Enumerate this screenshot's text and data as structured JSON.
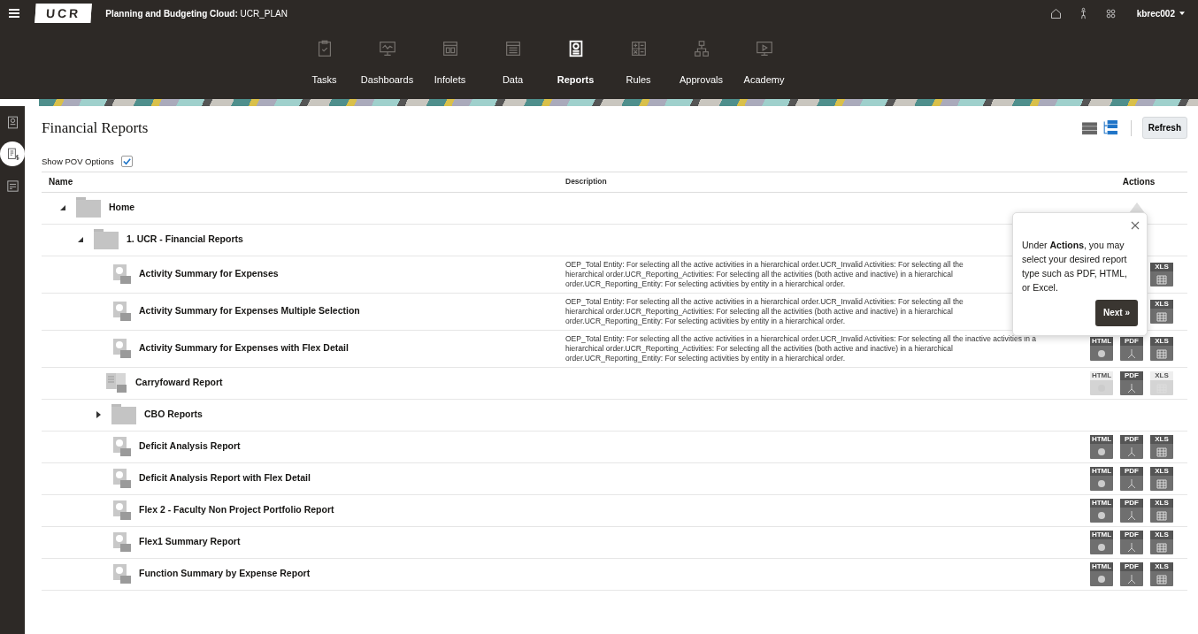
{
  "header": {
    "title_bold": "Planning and Budgeting Cloud:",
    "title": "UCR_PLAN",
    "logo": "UCR",
    "user": "kbrec002"
  },
  "nav": [
    {
      "label": "Tasks",
      "selected": false
    },
    {
      "label": "Dashboards",
      "selected": false
    },
    {
      "label": "Infolets",
      "selected": false
    },
    {
      "label": "Data",
      "selected": false
    },
    {
      "label": "Reports",
      "selected": true
    },
    {
      "label": "Rules",
      "selected": false
    },
    {
      "label": "Approvals",
      "selected": false
    },
    {
      "label": "Academy",
      "selected": false
    }
  ],
  "sidebar": {
    "items": [
      {
        "selected": false
      },
      {
        "selected": true
      },
      {
        "selected": false
      }
    ]
  },
  "page": {
    "title": "Financial Reports",
    "refresh": "Refresh",
    "views": [
      {
        "selected": false
      },
      {
        "selected": true
      }
    ],
    "show_pov": {
      "label": "Show POV Options",
      "checked": true
    }
  },
  "table": {
    "columns": [
      "Name",
      "Description",
      "Actions"
    ],
    "rows": [
      {
        "kind": "folder",
        "name": "Home",
        "expanded": true,
        "children": [
          {
            "kind": "folder",
            "name": "1. UCR - Financial Reports",
            "expanded": true,
            "children": [
              {
                "kind": "report",
                "name": "Activity Summary for Expenses",
                "description": [
                  "OEP_Total Entity: For selecting all the active activities in a hierarchical order.UCR_Invalid Activities: For selecting all the",
                  "hierarchical order.UCR_Reporting_Activities: For selecting all the activities (both active and inactive) in a hierarchical",
                  "order.UCR_Reporting_Entity: For selecting activities by entity in a hierarchical order."
                ],
                "actions": [
                  {
                    "kind": "xls",
                    "label": "XLS",
                    "disabled": false
                  }
                ]
              },
              {
                "kind": "report",
                "name": "Activity Summary for Expenses Multiple Selection",
                "description": [
                  "OEP_Total Entity: For selecting all the active activities in a hierarchical order.UCR_Invalid Activities: For selecting all the",
                  "hierarchical order.UCR_Reporting_Activities: For selecting all the activities (both active and inactive) in a hierarchical",
                  "order.UCR_Reporting_Entity: For selecting activities by entity in a hierarchical order."
                ],
                "actions": [
                  {
                    "kind": "xls",
                    "label": "XLS",
                    "disabled": false
                  }
                ]
              },
              {
                "kind": "report",
                "name": "Activity Summary for Expenses with Flex Detail",
                "description": [
                  "OEP_Total Entity: For selecting all the active activities in a hierarchical order.UCR_Invalid Activities: For selecting all the inactive activities in a",
                  "hierarchical order.UCR_Reporting_Activities: For selecting all the activities (both active and inactive) in a hierarchical",
                  "order.UCR_Reporting_Entity: For selecting activities by entity in a hierarchical order."
                ],
                "actions": [
                  {
                    "kind": "html",
                    "label": "HTML",
                    "disabled": false
                  },
                  {
                    "kind": "pdf",
                    "label": "PDF",
                    "disabled": false
                  },
                  {
                    "kind": "xls",
                    "label": "XLS",
                    "disabled": false
                  }
                ]
              },
              {
                "kind": "book",
                "name": "Carryfoward Report",
                "actions": [
                  {
                    "kind": "html",
                    "label": "HTML",
                    "disabled": true
                  },
                  {
                    "kind": "pdf",
                    "label": "PDF",
                    "disabled": false
                  },
                  {
                    "kind": "xls",
                    "label": "XLS",
                    "disabled": true
                  }
                ]
              },
              {
                "kind": "folder",
                "name": "CBO Reports",
                "expanded": false
              },
              {
                "kind": "report",
                "name": "Deficit Analysis Report",
                "actions": [
                  {
                    "kind": "html",
                    "label": "HTML",
                    "disabled": false
                  },
                  {
                    "kind": "pdf",
                    "label": "PDF",
                    "disabled": false
                  },
                  {
                    "kind": "xls",
                    "label": "XLS",
                    "disabled": false
                  }
                ]
              },
              {
                "kind": "report",
                "name": "Deficit Analysis Report with Flex Detail",
                "actions": [
                  {
                    "kind": "html",
                    "label": "HTML",
                    "disabled": false
                  },
                  {
                    "kind": "pdf",
                    "label": "PDF",
                    "disabled": false
                  },
                  {
                    "kind": "xls",
                    "label": "XLS",
                    "disabled": false
                  }
                ]
              },
              {
                "kind": "report",
                "name": "Flex 2 - Faculty Non Project Portfolio Report",
                "actions": [
                  {
                    "kind": "html",
                    "label": "HTML",
                    "disabled": false
                  },
                  {
                    "kind": "pdf",
                    "label": "PDF",
                    "disabled": false
                  },
                  {
                    "kind": "xls",
                    "label": "XLS",
                    "disabled": false
                  }
                ]
              },
              {
                "kind": "report",
                "name": "Flex1 Summary Report",
                "actions": [
                  {
                    "kind": "html",
                    "label": "HTML",
                    "disabled": false
                  },
                  {
                    "kind": "pdf",
                    "label": "PDF",
                    "disabled": false
                  },
                  {
                    "kind": "xls",
                    "label": "XLS",
                    "disabled": false
                  }
                ]
              },
              {
                "kind": "report",
                "name": "Function Summary by Expense Report",
                "actions": [
                  {
                    "kind": "html",
                    "label": "HTML",
                    "disabled": false
                  },
                  {
                    "kind": "pdf",
                    "label": "PDF",
                    "disabled": false
                  },
                  {
                    "kind": "xls",
                    "label": "XLS",
                    "disabled": false
                  }
                ]
              }
            ]
          }
        ]
      }
    ]
  },
  "popover": {
    "text": "Under **Actions**, you may select your desired report type such as PDF, HTML, or Excel.",
    "button": "Next »"
  }
}
